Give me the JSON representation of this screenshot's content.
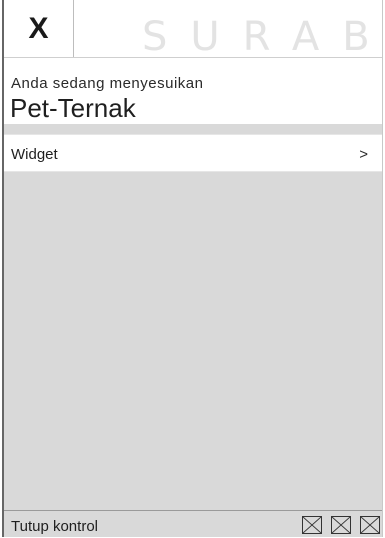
{
  "topbar": {
    "close_label": "X",
    "watermark_text": "SURAB"
  },
  "header": {
    "subtitle": "Anda sedang menyesuikan",
    "title": "Pet-Ternak"
  },
  "menu": {
    "items": [
      {
        "label": "Widget",
        "chevron": ">"
      }
    ]
  },
  "footer": {
    "label": "Tutup kontrol",
    "icons": [
      "placeholder-x-icon",
      "placeholder-x-icon",
      "placeholder-x-icon"
    ]
  },
  "colors": {
    "background": "#d9d9d9",
    "panel": "#ffffff",
    "text": "#1f1f1f"
  }
}
